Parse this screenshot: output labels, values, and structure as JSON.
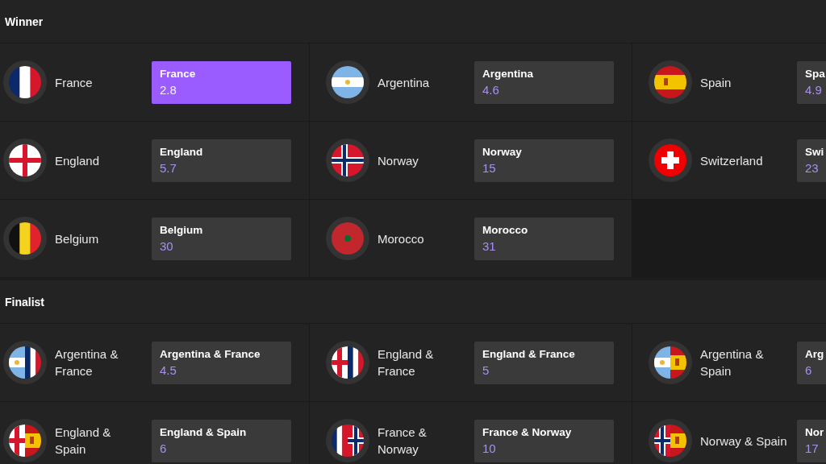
{
  "sections": [
    {
      "title": "Winner",
      "markets": [
        {
          "name": "France",
          "flags": [
            {
              "kind": "fr"
            }
          ],
          "odds_label": "France",
          "odds": "2.8",
          "selected": true
        },
        {
          "name": "Argentina",
          "flags": [
            {
              "kind": "ar"
            }
          ],
          "odds_label": "Argentina",
          "odds": "4.6",
          "selected": false
        },
        {
          "name": "Spain",
          "flags": [
            {
              "kind": "es"
            }
          ],
          "odds_label": "Spa",
          "odds": "4.9",
          "selected": false
        },
        {
          "name": "England",
          "flags": [
            {
              "kind": "en"
            }
          ],
          "odds_label": "England",
          "odds": "5.7",
          "selected": false
        },
        {
          "name": "Norway",
          "flags": [
            {
              "kind": "no"
            }
          ],
          "odds_label": "Norway",
          "odds": "15",
          "selected": false
        },
        {
          "name": "Switzerland",
          "flags": [
            {
              "kind": "ch"
            }
          ],
          "odds_label": "Swi",
          "odds": "23",
          "selected": false
        },
        {
          "name": "Belgium",
          "flags": [
            {
              "kind": "be"
            }
          ],
          "odds_label": "Belgium",
          "odds": "30",
          "selected": false
        },
        {
          "name": "Morocco",
          "flags": [
            {
              "kind": "ma"
            }
          ],
          "odds_label": "Morocco",
          "odds": "31",
          "selected": false
        }
      ]
    },
    {
      "title": "Finalist",
      "markets": [
        {
          "name": "Argentina & France",
          "flags": [
            {
              "kind": "ar"
            },
            {
              "kind": "fr"
            }
          ],
          "odds_label": "Argentina & France",
          "odds": "4.5",
          "selected": false
        },
        {
          "name": "England & France",
          "flags": [
            {
              "kind": "en"
            },
            {
              "kind": "fr"
            }
          ],
          "odds_label": "England & France",
          "odds": "5",
          "selected": false
        },
        {
          "name": "Argentina & Spain",
          "flags": [
            {
              "kind": "ar"
            },
            {
              "kind": "es"
            }
          ],
          "odds_label": "Arg",
          "odds": "6",
          "selected": false
        },
        {
          "name": "England & Spain",
          "flags": [
            {
              "kind": "en"
            },
            {
              "kind": "es"
            }
          ],
          "odds_label": "England & Spain",
          "odds": "6",
          "selected": false
        },
        {
          "name": "France & Norway",
          "flags": [
            {
              "kind": "fr"
            },
            {
              "kind": "no"
            }
          ],
          "odds_label": "France & Norway",
          "odds": "10",
          "selected": false
        },
        {
          "name": "Norway & Spain",
          "flags": [
            {
              "kind": "no"
            },
            {
              "kind": "es"
            }
          ],
          "odds_label": "Nor",
          "odds": "17",
          "selected": false
        }
      ]
    }
  ]
}
